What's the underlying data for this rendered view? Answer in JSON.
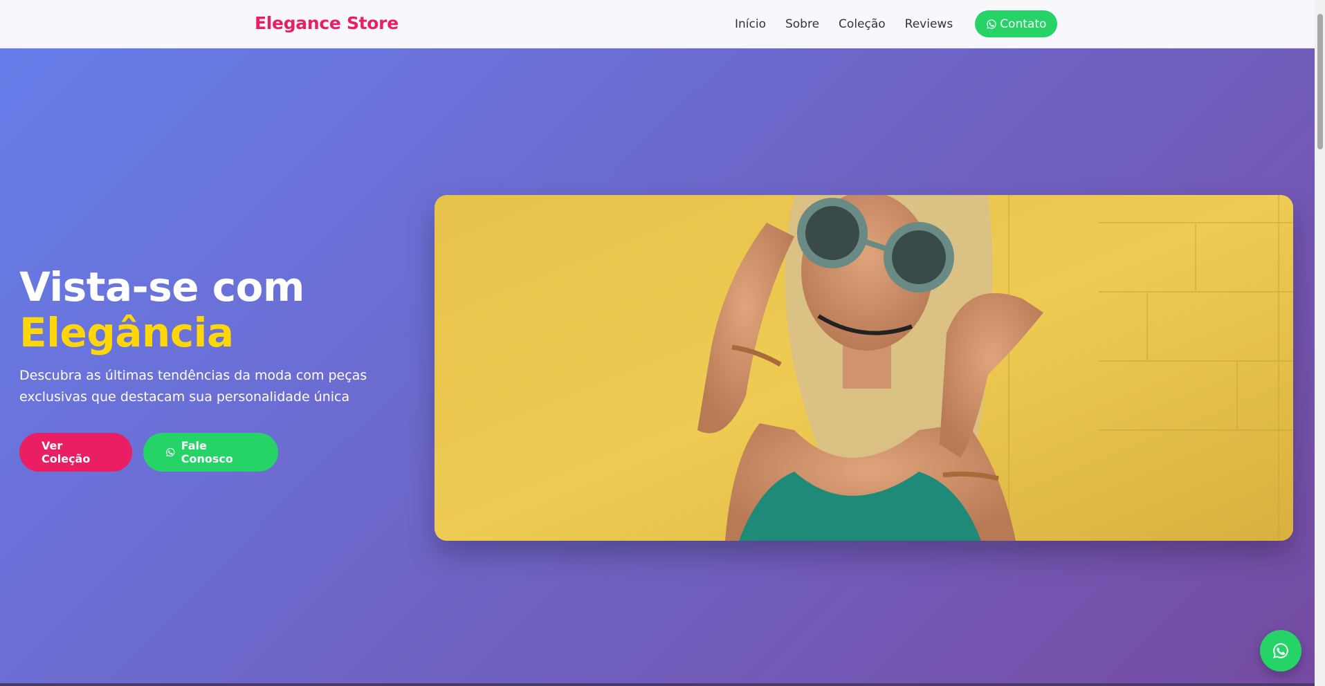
{
  "nav": {
    "brand": "Elegance Store",
    "links": [
      "Início",
      "Sobre",
      "Coleção",
      "Reviews"
    ],
    "contact_label": "Contato"
  },
  "hero": {
    "title_line1": "Vista-se com",
    "title_line2": "Elegância",
    "subtitle": "Descubra as últimas tendências da moda com peças exclusivas que destacam sua personalidade única",
    "primary_button": "Ver Coleção",
    "secondary_button": "Fale Conosco",
    "image_icon": "fashion-photo"
  },
  "colors": {
    "brand": "#e91e63",
    "whatsapp": "#25d366",
    "accent_yellow": "#ffd60a",
    "gradient_start": "#667eea",
    "gradient_end": "#764ba2"
  },
  "icons": {
    "whatsapp": "whatsapp-icon"
  }
}
